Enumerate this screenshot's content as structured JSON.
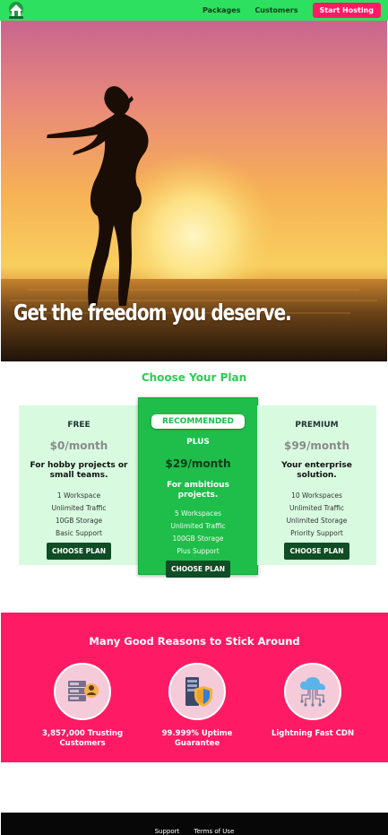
{
  "nav": {
    "logo_icon": "house-leaf-logo-icon",
    "links": [
      "Packages",
      "Customers"
    ],
    "cta": "Start Hosting"
  },
  "hero": {
    "title": "Get the freedom you deserve."
  },
  "plans": {
    "title": "Choose Your Plan",
    "free": {
      "name": "FREE",
      "price": "$0/month",
      "desc": "For hobby projects or small teams.",
      "features": [
        "1 Workspace",
        "Unlimited Traffic",
        "10GB Storage",
        "Basic Support"
      ],
      "button": "CHOOSE PLAN"
    },
    "plus": {
      "badge": "RECOMMENDED",
      "name": "PLUS",
      "price": "$29/month",
      "desc": "For ambitious projects.",
      "features": [
        "5 Workspaces",
        "Unlimited Traffic",
        "100GB Storage",
        "Plus Support"
      ],
      "button": "CHOOSE PLAN"
    },
    "premium": {
      "name": "PREMIUM",
      "price": "$99/month",
      "desc": "Your enterprise solution.",
      "features": [
        "10 Workspaces",
        "Unlimited Traffic",
        "Unlimited Storage",
        "Priority Support"
      ],
      "button": "CHOOSE PLAN"
    }
  },
  "reasons": {
    "title": "Many Good Reasons to Stick Around",
    "items": [
      {
        "icon": "customers-server-icon",
        "label": "3,857,000 Trusting Customers"
      },
      {
        "icon": "shield-server-icon",
        "label": "99.999% Uptime Guarantee"
      },
      {
        "icon": "cloud-cdn-icon",
        "label": "Lightning Fast CDN"
      }
    ]
  },
  "footer": {
    "links": [
      "Support",
      "Terms of Use"
    ]
  },
  "colors": {
    "nav_green": "#2ee05f",
    "accent_pink": "#ff1a66",
    "recommended_green": "#1fbd4a",
    "card_mint": "#d8fbe0"
  }
}
